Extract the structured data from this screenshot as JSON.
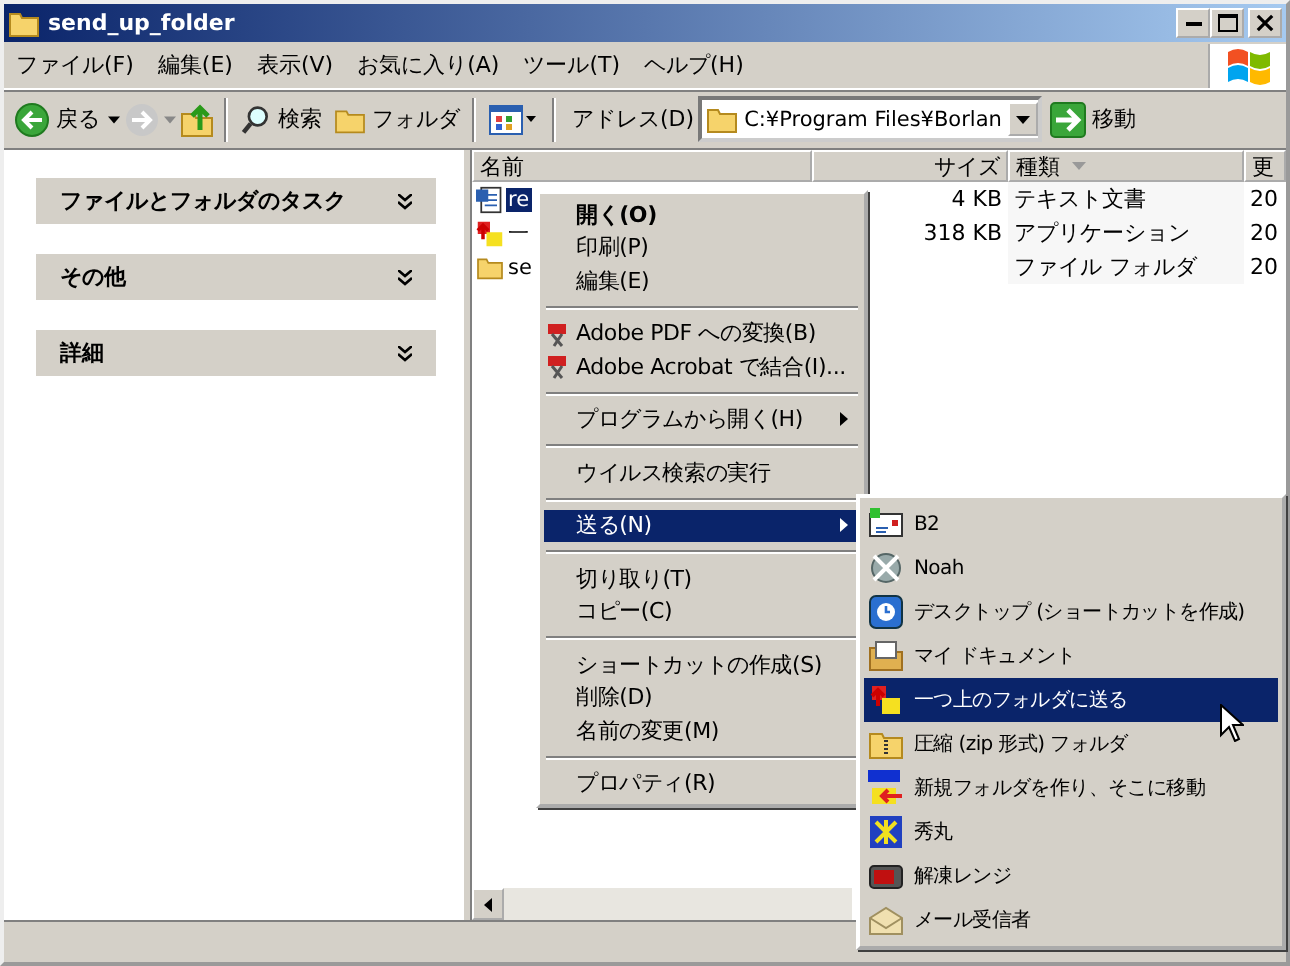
{
  "window": {
    "title": "send_up_folder"
  },
  "menu_bar": [
    "ファイル(F)",
    "編集(E)",
    "表示(V)",
    "お気に入り(A)",
    "ツール(T)",
    "ヘルプ(H)"
  ],
  "toolbar": {
    "back": "戻る",
    "search": "検索",
    "folders": "フォルダ",
    "address_label": "アドレス(D)",
    "address": "C:¥Program Files¥Borlan",
    "go": "移動"
  },
  "task_pane": [
    {
      "title": "ファイルとフォルダのタスク"
    },
    {
      "title": "その他"
    },
    {
      "title": "詳細"
    }
  ],
  "file_list": {
    "columns": [
      "名前",
      "サイズ",
      "種類",
      "更"
    ],
    "rows": [
      {
        "kind": "text",
        "name": "re",
        "size": "4 KB",
        "type": "テキスト文書",
        "column_4": "20",
        "selected": true
      },
      {
        "kind": "app",
        "name": "一",
        "size": "318 KB",
        "type": "アプリケーション",
        "column_4": "20",
        "selected": false
      },
      {
        "kind": "folder",
        "name": "se",
        "size": "",
        "type": "ファイル フォルダ",
        "column_4": "20",
        "selected": false
      }
    ]
  },
  "context_menu": [
    {
      "kind": "item",
      "label": "開く(O)",
      "default": true,
      "selected": false
    },
    {
      "kind": "item",
      "label": "印刷(P)",
      "selected": false
    },
    {
      "kind": "item",
      "label": "編集(E)",
      "selected": false
    },
    {
      "kind": "separator"
    },
    {
      "kind": "item",
      "label": "Adobe PDF への変換(B)",
      "selected": false
    },
    {
      "kind": "item",
      "label": "Adobe Acrobat で結合(I)...",
      "selected": false
    },
    {
      "kind": "separator"
    },
    {
      "kind": "item",
      "label": "プログラムから開く(H)",
      "submenu": true,
      "selected": false
    },
    {
      "kind": "separator"
    },
    {
      "kind": "item",
      "label": "ウイルス検索の実行",
      "selected": false
    },
    {
      "kind": "separator"
    },
    {
      "kind": "item",
      "label": "送る(N)",
      "submenu": true,
      "selected": true
    },
    {
      "kind": "separator"
    },
    {
      "kind": "item",
      "label": "切り取り(T)",
      "selected": false
    },
    {
      "kind": "item",
      "label": "コピー(C)",
      "selected": false
    },
    {
      "kind": "separator"
    },
    {
      "kind": "item",
      "label": "ショートカットの作成(S)",
      "selected": false
    },
    {
      "kind": "item",
      "label": "削除(D)",
      "selected": false
    },
    {
      "kind": "item",
      "label": "名前の変更(M)",
      "selected": false
    },
    {
      "kind": "separator"
    },
    {
      "kind": "item",
      "label": "プロパティ(R)",
      "selected": false
    }
  ],
  "send_to_menu": [
    {
      "label": "B2",
      "selected": false
    },
    {
      "label": "Noah",
      "selected": false
    },
    {
      "label": "デスクトップ (ショートカットを作成)",
      "selected": false
    },
    {
      "label": "マイ ドキュメント",
      "selected": false
    },
    {
      "label": "一つ上のフォルダに送る",
      "selected": true
    },
    {
      "label": "圧縮 (zip 形式) フォルダ",
      "selected": false
    },
    {
      "label": "新規フォルダを作り、そこに移動",
      "selected": false
    },
    {
      "label": "秀丸",
      "selected": false
    },
    {
      "label": "解凍レンジ",
      "selected": false
    },
    {
      "label": "メール受信者",
      "selected": false
    }
  ]
}
